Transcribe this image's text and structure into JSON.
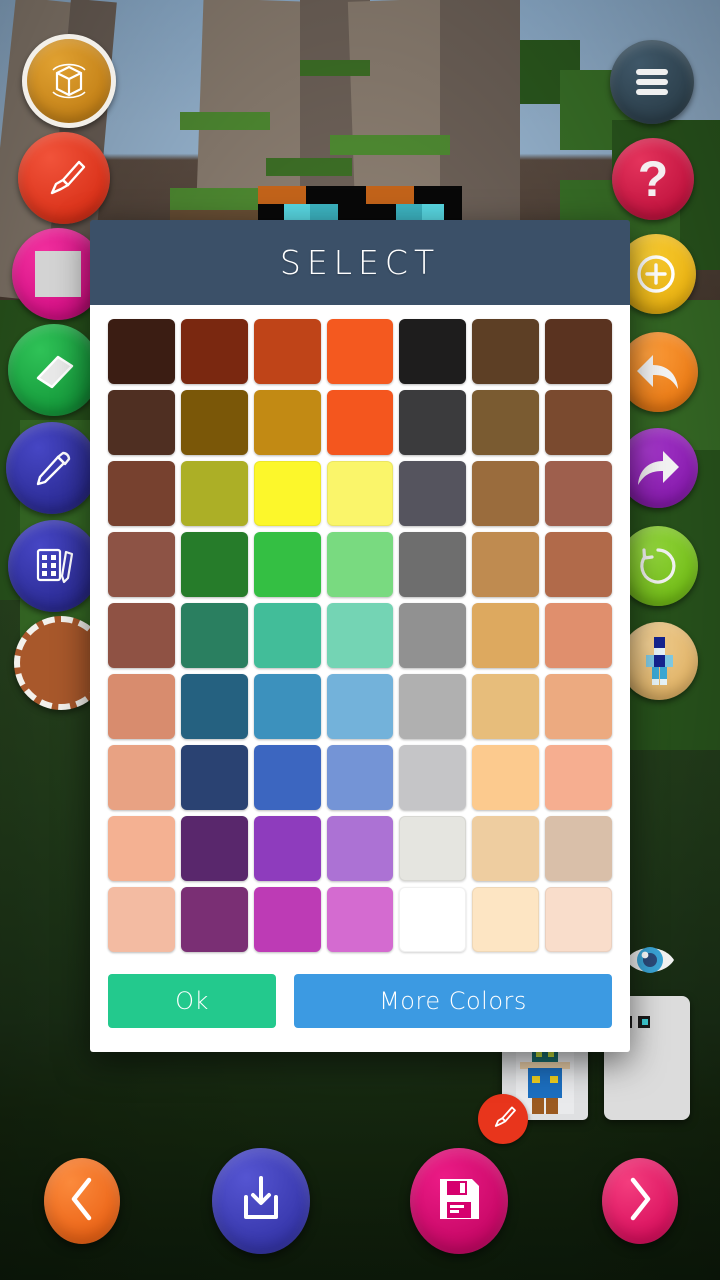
{
  "app": {
    "background": "minecraft-world-scene",
    "background_sky": "#9ab8d4"
  },
  "dialog": {
    "title": "SELECT",
    "header_color": "#3b5068",
    "body_color": "#ffffff",
    "ok_label": "Ok",
    "ok_color": "#23c98d",
    "more_colors_label": "More Colors",
    "more_colors_color": "#3c9ae2",
    "grid": {
      "columns": 7,
      "rows": 9,
      "colors": [
        [
          "#3b1d13",
          "#7a2810",
          "#bf4418",
          "#f4591f",
          "#1e1d1d",
          "#5d3f25",
          "#5a3320"
        ],
        [
          "#4f2f22",
          "#7a5708",
          "#c28a14",
          "#f4561e",
          "#3b3b3d",
          "#7a5b31",
          "#7a4a2f"
        ],
        [
          "#77412f",
          "#acaf26",
          "#fcf72b",
          "#faf56a",
          "#55545e",
          "#9a6c3d",
          "#9e5f4d"
        ],
        [
          "#8d5345",
          "#267c2a",
          "#34bf43",
          "#79da80",
          "#6e6e6e",
          "#bf8b50",
          "#b16a4a"
        ],
        [
          "#8f5244",
          "#2a7f60",
          "#42bd99",
          "#74d4b4",
          "#919191",
          "#dda95f",
          "#e08f6d"
        ],
        [
          "#d88c6e",
          "#256180",
          "#3c91bd",
          "#73b2da",
          "#b0b0b0",
          "#e7bd7b",
          "#ecaa80"
        ],
        [
          "#e8a283",
          "#2a4272",
          "#3c66c0",
          "#7494d6",
          "#c5c5c7",
          "#fcca8e",
          "#f6ae90"
        ],
        [
          "#f4b192",
          "#59276c",
          "#8e3cbd",
          "#ac72d4",
          "#e5e5e0",
          "#eecda0",
          "#d9bfa9"
        ],
        [
          "#f3bba2",
          "#7a2f74",
          "#bd3bb5",
          "#d46bd0",
          "#ffffff",
          "#fde5c3",
          "#f9ddcb"
        ]
      ]
    }
  },
  "left_toolbar": {
    "items": [
      {
        "name": "rotate-model-tool",
        "icon": "cube-rotate-icon",
        "color": "#c87f16",
        "selected": true
      },
      {
        "name": "brush-tool",
        "icon": "paintbrush-icon",
        "color": "#e8351c",
        "selected": false
      },
      {
        "name": "fill-tool",
        "icon": "fill-square-icon",
        "color": "#e4128b",
        "selected": false
      },
      {
        "name": "eraser-tool",
        "icon": "eraser-icon",
        "color": "#17a03e",
        "selected": false
      },
      {
        "name": "eyedropper-tool",
        "icon": "eyedropper-icon",
        "color": "#2f2f9e",
        "selected": false
      },
      {
        "name": "pattern-tool",
        "icon": "stamp-pattern-icon",
        "color": "#2f2f9e",
        "selected": false
      }
    ],
    "current_color_swatch": "#a8582b"
  },
  "right_toolbar": {
    "items": [
      {
        "name": "menu-button",
        "icon": "hamburger-menu-icon",
        "color": "#2e4250"
      },
      {
        "name": "help-button",
        "icon": "question-mark-icon",
        "color": "#d1123f"
      },
      {
        "name": "add-button",
        "icon": "plus-circle-icon",
        "color": "#f0b60d"
      },
      {
        "name": "undo-button",
        "icon": "undo-arrow-icon",
        "color": "#f08213"
      },
      {
        "name": "redo-button",
        "icon": "redo-arrow-icon",
        "color": "#8f22b5"
      },
      {
        "name": "reset-button",
        "icon": "refresh-circle-icon",
        "color": "#7ac620"
      },
      {
        "name": "skin-preview-button",
        "icon": "skin-figure-icon",
        "color": "#e8c07a"
      }
    ]
  },
  "bottom_nav": {
    "items": [
      {
        "name": "previous-button",
        "icon": "chevron-left-icon",
        "color": "#f26716"
      },
      {
        "name": "import-button",
        "icon": "download-box-icon",
        "color": "#3b3bb5"
      },
      {
        "name": "save-button",
        "icon": "floppy-disk-icon",
        "color": "#d6006e"
      },
      {
        "name": "next-button",
        "icon": "chevron-right-icon",
        "color": "#e51363"
      }
    ]
  },
  "preview": {
    "eye_toggle_name": "visibility-toggle",
    "skin_card_name": "skin-thumbnail",
    "blank_card_name": "blank-skin-thumbnail"
  }
}
